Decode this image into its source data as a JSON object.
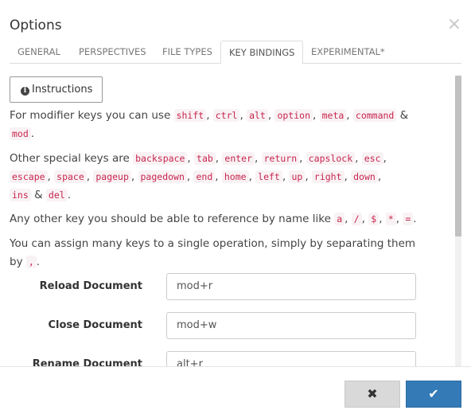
{
  "dialog": {
    "title": "Options",
    "close_glyph": "×"
  },
  "tabs": [
    {
      "label": "GENERAL"
    },
    {
      "label": "PERSPECTIVES"
    },
    {
      "label": "FILE TYPES"
    },
    {
      "label": "KEY BINDINGS",
      "active": true
    },
    {
      "label": "EXPERIMENTAL*"
    }
  ],
  "instructions": {
    "button_label": "Instructions",
    "icon": "info-circle-icon",
    "p1_prefix": "For modifier keys you can use",
    "modifier_keys": [
      "shift",
      "ctrl",
      "alt",
      "option",
      "meta",
      "command"
    ],
    "last_modifier": "mod",
    "p2_prefix": "Other special keys are",
    "special_keys": [
      "backspace",
      "tab",
      "enter",
      "return",
      "capslock",
      "esc",
      "escape",
      "space",
      "pageup",
      "pagedown",
      "end",
      "home",
      "left",
      "up",
      "right",
      "down",
      "ins"
    ],
    "last_special": "del",
    "p3_prefix": "Any other key you should be able to reference by name like",
    "example_keys": [
      "a",
      "/",
      "$",
      "*",
      "="
    ],
    "p4_prefix": "You can assign many keys to a single operation, simply by separating them by",
    "separator": ","
  },
  "bindings": [
    {
      "label": "Reload Document",
      "value": "mod+r"
    },
    {
      "label": "Close Document",
      "value": "mod+w"
    },
    {
      "label": "Rename Document",
      "value": "alt+r"
    }
  ],
  "footer": {
    "cancel_glyph": "✖",
    "ok_glyph": "✔"
  },
  "colors": {
    "primary": "#337ab7",
    "code_text": "#c7254e",
    "code_bg": "#f9f2f4"
  }
}
